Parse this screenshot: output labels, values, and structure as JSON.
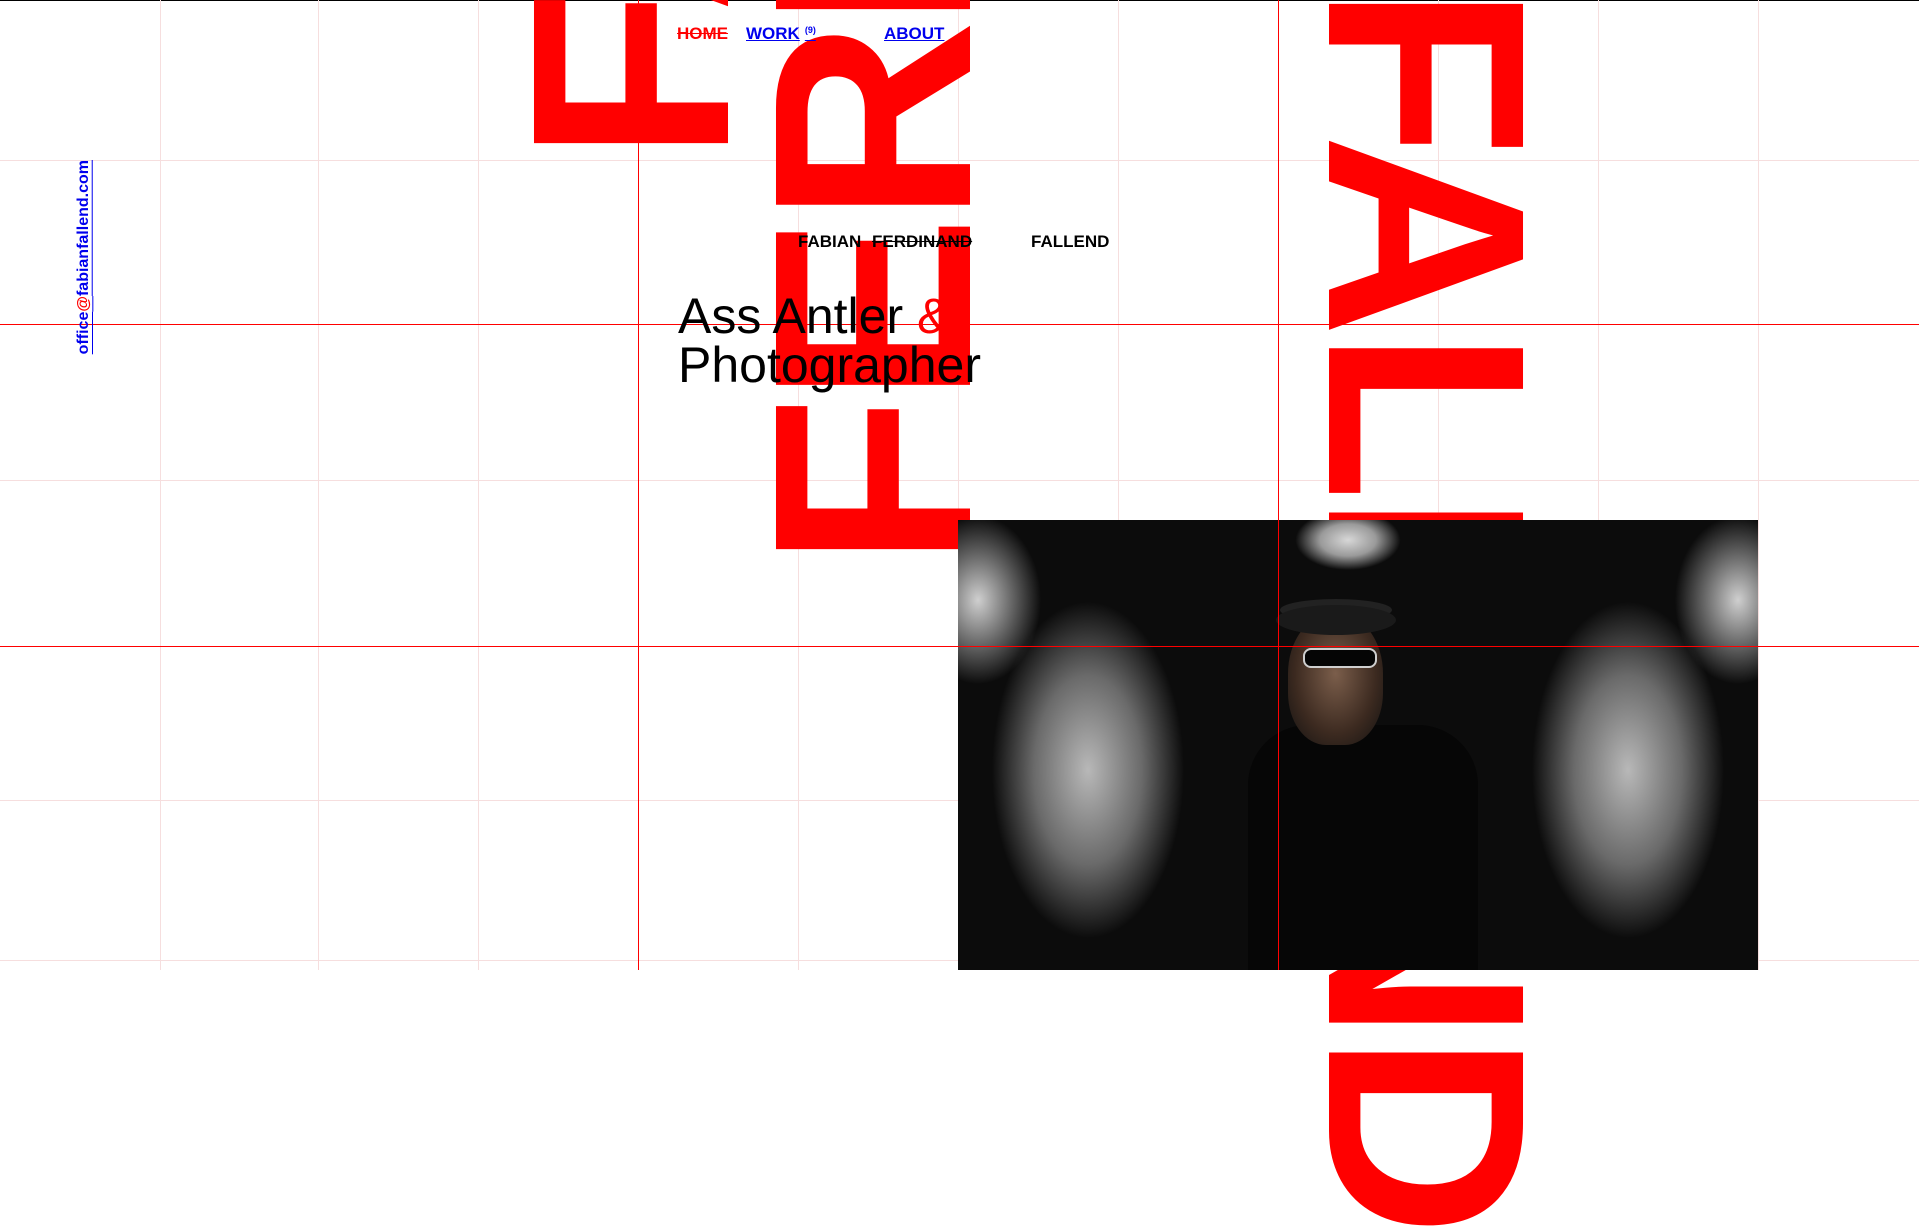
{
  "nav": {
    "home_label": "HOME",
    "work_label": "WORK",
    "work_count": "(9)",
    "about_label": "ABOUT"
  },
  "contact": {
    "email_user": "office",
    "email_at": "@",
    "email_domain": "fabianfallend.com"
  },
  "name": {
    "first": "FABIAN",
    "middle": "FERDINAND",
    "last": "FALLEND"
  },
  "headline": {
    "line1": "Ass Antler ",
    "ampersand": "&",
    "line2": "Photographer"
  },
  "big_type": {
    "left_word": "FABIAN",
    "middle_word": "FERDINAND",
    "right_word": "FALLEND"
  },
  "colors": {
    "accent": "#ff0000",
    "text": "#000000",
    "background": "#ffffff"
  }
}
